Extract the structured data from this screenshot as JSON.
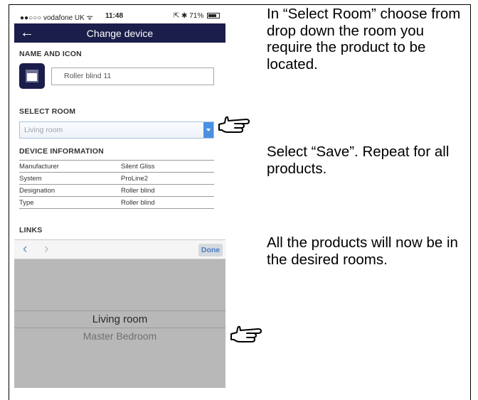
{
  "status_bar": {
    "carrier": "●●○○○ vodafone UK ᯤ",
    "time": "11:48",
    "indicators": "⇱ ✱ 71%"
  },
  "nav": {
    "back_icon": "back-arrow-icon",
    "title": "Change device"
  },
  "name_and_icon": {
    "heading": "NAME AND ICON",
    "name_value": "Roller blind 11"
  },
  "select_room": {
    "heading": "SELECT ROOM",
    "selected": "Living room"
  },
  "device_information": {
    "heading": "DEVICE INFORMATION",
    "rows": [
      {
        "label": "Manufacturer",
        "value": "Silent Gliss"
      },
      {
        "label": "System",
        "value": "ProLine2"
      },
      {
        "label": "Designation",
        "value": "Roller blind"
      },
      {
        "label": "Type",
        "value": "Roller blind"
      }
    ]
  },
  "links": {
    "heading": "LINKS"
  },
  "picker": {
    "prev_icon": "‹",
    "next_icon": "›",
    "done_label": "Done",
    "options": [
      "Living room",
      "Master Bedroom"
    ]
  },
  "instructions": {
    "step1": "In “Select Room” choose from drop down the room you require the product to be located.",
    "step2": "Select “Save”. Repeat for all products.",
    "step3": "All the products will now be in the desired rooms."
  },
  "colors": {
    "navbar": "#1b1e4a",
    "accent": "#4a90e2",
    "picker_bg": "#b8b8b8"
  }
}
